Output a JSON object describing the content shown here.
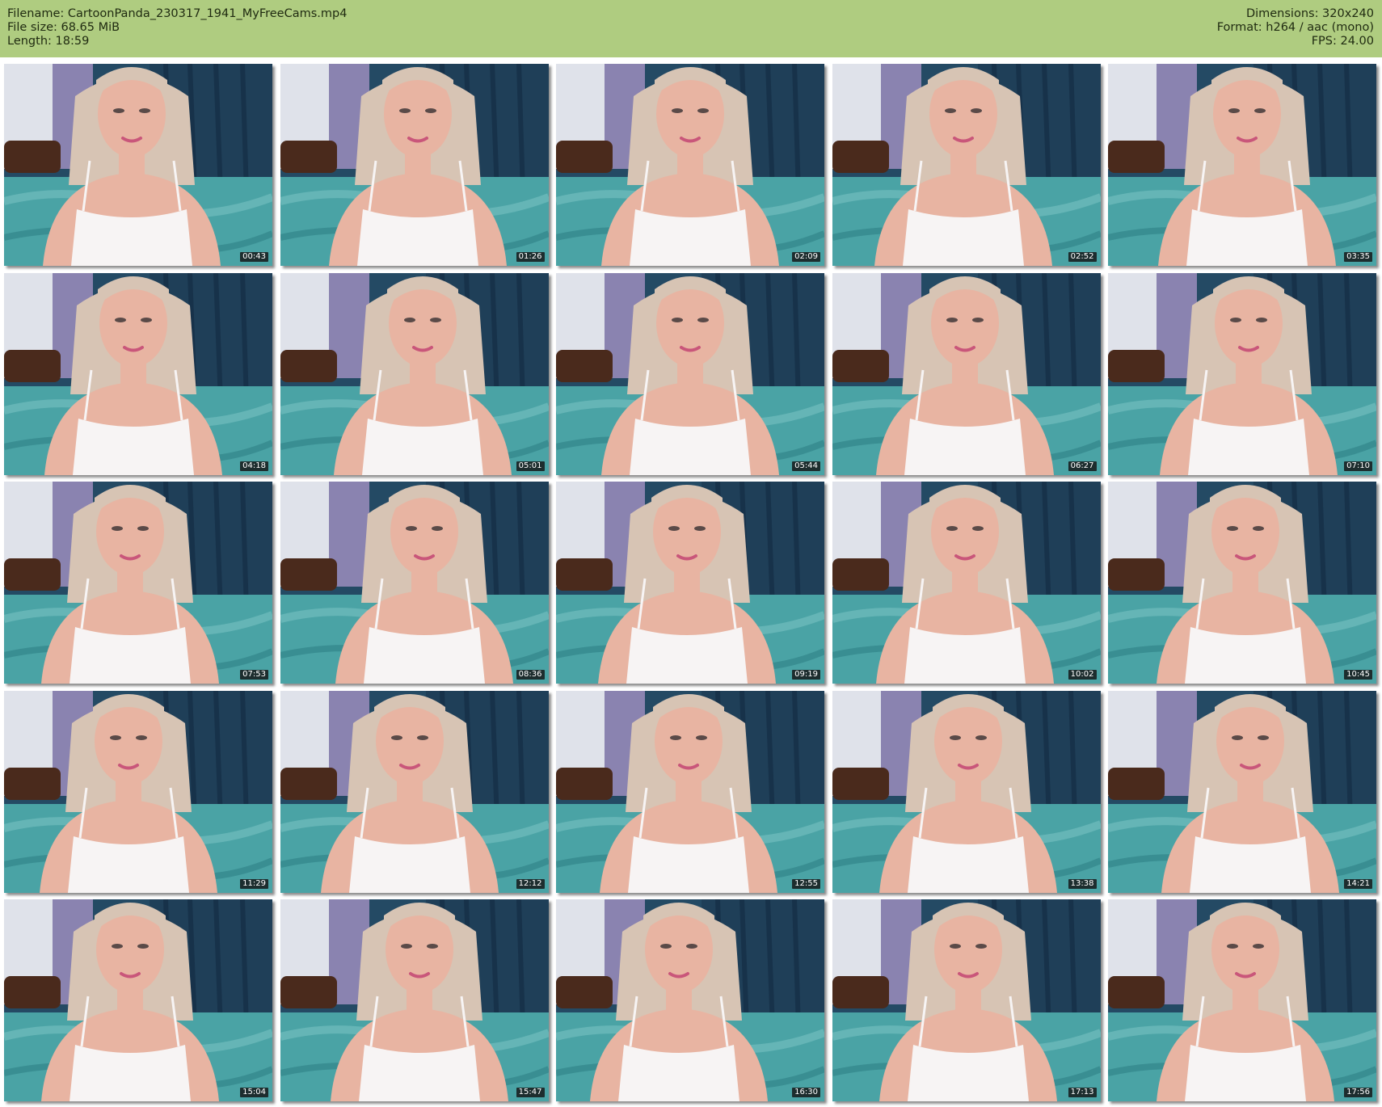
{
  "header": {
    "filename_label": "Filename: CartoonPanda_230317_1941_MyFreeCams.mp4",
    "filesize_label": "File size: 68.65 MiB",
    "length_label": "Length: 18:59",
    "dimensions_label": "Dimensions: 320x240",
    "format_label": "Format: h264 / aac (mono)",
    "fps_label": "FPS: 24.00"
  },
  "colors": {
    "header_bg": "#afcc80",
    "wall": "#8a83b0",
    "curtain": "#244a64",
    "bedspread": "#4aa3a5",
    "hair": "#d7c4b4",
    "skin": "#e8b4a2",
    "top": "#f7f4f4"
  },
  "thumbnails": [
    {
      "time": "00:43"
    },
    {
      "time": "01:26"
    },
    {
      "time": "02:09"
    },
    {
      "time": "02:52"
    },
    {
      "time": "03:35"
    },
    {
      "time": "04:18"
    },
    {
      "time": "05:01"
    },
    {
      "time": "05:44"
    },
    {
      "time": "06:27"
    },
    {
      "time": "07:10"
    },
    {
      "time": "07:53"
    },
    {
      "time": "08:36"
    },
    {
      "time": "09:19"
    },
    {
      "time": "10:02"
    },
    {
      "time": "10:45"
    },
    {
      "time": "11:29"
    },
    {
      "time": "12:12"
    },
    {
      "time": "12:55"
    },
    {
      "time": "13:38"
    },
    {
      "time": "14:21"
    },
    {
      "time": "15:04"
    },
    {
      "time": "15:47"
    },
    {
      "time": "16:30"
    },
    {
      "time": "17:13"
    },
    {
      "time": "17:56"
    }
  ]
}
